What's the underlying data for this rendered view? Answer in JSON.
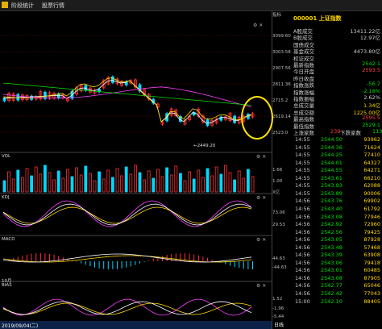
{
  "tabs": [
    "阶段统计",
    "股票行情"
  ],
  "axis_top": "指标",
  "main_panel": {
    "price_ticks": [
      "3099.60",
      "3003.58",
      "2907.56",
      "2811.36",
      "2715.2",
      "2619.14",
      "2523.0"
    ],
    "low_label": "←2449.20",
    "xaxis_month": "10月",
    "controls": "⚙ ✕"
  },
  "panels": [
    {
      "id": "vol",
      "name": "VOL",
      "ticks": [
        "1.66",
        "1.00",
        "X亿"
      ],
      "controls": "⚙ ✕"
    },
    {
      "id": "kdj",
      "name": "KDJ",
      "ticks": [
        "73.06",
        "29.53"
      ],
      "controls": "⚙ ✕"
    },
    {
      "id": "macd",
      "name": "MACD",
      "ticks": [
        "44.63",
        "-44.63"
      ],
      "controls": "⚙ ✕"
    },
    {
      "id": "bias",
      "name": "BIAS",
      "ticks": [
        "1.52",
        "-1.96",
        "-5.44"
      ],
      "controls": "⚙ ✕"
    }
  ],
  "bottom_label": "2019/09/04(二)",
  "day_label": "日线",
  "quote": {
    "code": "000001 上证指数",
    "rows": [
      {
        "label": "A股成交",
        "value": "13411.22亿",
        "color": "#ccc"
      },
      {
        "label": "B股成交",
        "value": "12.97亿",
        "color": "#ccc"
      },
      {
        "label": "国债成交",
        "value": "",
        "color": "#ccc"
      },
      {
        "label": "基金成交",
        "value": "4473.80亿",
        "color": "#ccc"
      },
      {
        "label": "权证成交",
        "value": "",
        "color": "#ccc"
      },
      {
        "label": "最新指数",
        "value": "2542.1",
        "color": "#00e000"
      },
      {
        "label": "今日开盘",
        "value": "2593.5",
        "color": "#ff4040"
      },
      {
        "label": "昨日收盘",
        "value": "",
        "color": "#ccc"
      },
      {
        "label": "指数涨跌",
        "value": "-56.7",
        "color": "#00e000"
      },
      {
        "label": "指数涨幅",
        "value": "-2.18%",
        "color": "#00e000"
      },
      {
        "label": "指数振幅",
        "value": "2.62%",
        "color": "#ccc"
      },
      {
        "label": "总成交量",
        "value": "1.34亿",
        "color": "#ffd700"
      },
      {
        "label": "总成交额",
        "value": "1225.00亿",
        "color": "#ffd700"
      },
      {
        "label": "最高指数",
        "value": "2595.5",
        "color": "#ff4040"
      },
      {
        "label": "最低指数",
        "value": "2529.1",
        "color": "#00e000"
      }
    ],
    "updown": {
      "up_label": "上涨家数",
      "up": "239",
      "down_label": "下跌家数",
      "down": "113"
    }
  },
  "ticks": [
    {
      "time": "14:55",
      "price": "2544.50",
      "vol": "93962"
    },
    {
      "time": "14:55",
      "price": "2544.36",
      "vol": "71624"
    },
    {
      "time": "14:55",
      "price": "2544.25",
      "vol": "77410"
    },
    {
      "time": "14:55",
      "price": "2544.01",
      "vol": "64327"
    },
    {
      "time": "14:55",
      "price": "2544.55",
      "vol": "64271"
    },
    {
      "time": "14:55",
      "price": "2543.61",
      "vol": "66210"
    },
    {
      "time": "14:55",
      "price": "2543.93",
      "vol": "62088"
    },
    {
      "time": "14:55",
      "price": "2543.89",
      "vol": "90006"
    },
    {
      "time": "14:56",
      "price": "2543.76",
      "vol": "69902"
    },
    {
      "time": "14:56",
      "price": "2543.40",
      "vol": "61792"
    },
    {
      "time": "14:56",
      "price": "2543.08",
      "vol": "77946"
    },
    {
      "time": "14:56",
      "price": "2542.92",
      "vol": "72960"
    },
    {
      "time": "14:56",
      "price": "2542.56",
      "vol": "79425"
    },
    {
      "time": "14:56",
      "price": "2543.05",
      "vol": "87928"
    },
    {
      "time": "14:56",
      "price": "2543.48",
      "vol": "57468"
    },
    {
      "time": "14:56",
      "price": "2543.39",
      "vol": "63908"
    },
    {
      "time": "14:56",
      "price": "2543.06",
      "vol": "79418"
    },
    {
      "time": "14:56",
      "price": "2543.01",
      "vol": "60485"
    },
    {
      "time": "14:56",
      "price": "2543.08",
      "vol": "87905"
    },
    {
      "time": "14:56",
      "price": "2542.77",
      "vol": "65046"
    },
    {
      "time": "14:56",
      "price": "2542.42",
      "vol": "77043"
    },
    {
      "time": "15:00",
      "price": "2542.10",
      "vol": "88405"
    }
  ],
  "colors": {
    "up": "#ff3030",
    "down": "#00d8ff",
    "ma5": "#ffffff",
    "ma10": "#ffd700",
    "ma20": "#ff40ff",
    "ma60": "#00e000"
  }
}
